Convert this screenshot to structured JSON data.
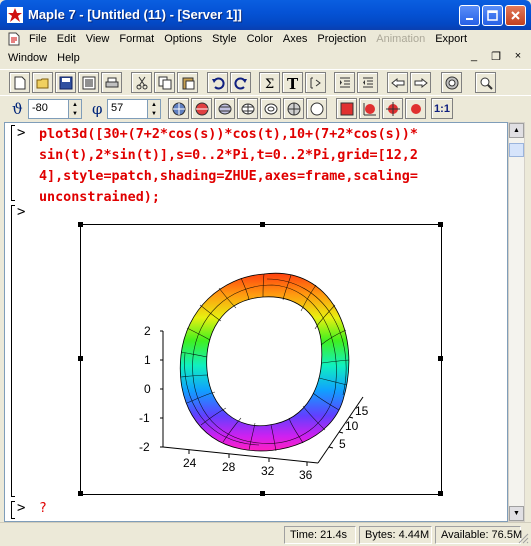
{
  "window": {
    "title": "Maple 7 - [Untitled (11) - [Server 1]]",
    "minimize_label": "_",
    "maximize_label": "□",
    "close_label": "×"
  },
  "menu": {
    "row1": [
      "File",
      "Edit",
      "View",
      "Format",
      "Options",
      "Style",
      "Color",
      "Axes",
      "Projection",
      "Animation",
      "Export"
    ],
    "row1_disabled": "Animation",
    "row2": [
      "Window",
      "Help"
    ],
    "mdi": {
      "minimize": "_",
      "restore": "❐",
      "close": "×"
    }
  },
  "toolbar2": {
    "theta_symbol": "ϑ",
    "theta_value": "-80",
    "phi_symbol": "φ",
    "phi_value": "57",
    "ratio_label": "1:1"
  },
  "worksheet": {
    "prompt": ">",
    "input_lines": [
      "plot3d([30+(7+2*cos(s))*cos(t),10+(7+2*cos(s))*",
      "sin(t),2*sin(t)],s=0..2*Pi,t=0..2*Pi,grid=[12,2",
      "4],style=patch,shading=ZHUE,axes=frame,scaling=",
      "unconstrained);"
    ],
    "empty_prompt": ">",
    "last_prompt": ">",
    "last_prompt_text": "?"
  },
  "plot": {
    "z_ticks": [
      "2",
      "1",
      "0",
      "-1",
      "-2"
    ],
    "x_ticks": [
      "24",
      "28",
      "32",
      "36"
    ],
    "y_ticks": [
      "15",
      "10",
      "5"
    ]
  },
  "status": {
    "time": "Time: 21.4s",
    "bytes": "Bytes: 4.44M",
    "available": "Available: 76.5M"
  },
  "colors": {
    "title_bar": "#0553d6",
    "input_text": "#e00000"
  }
}
